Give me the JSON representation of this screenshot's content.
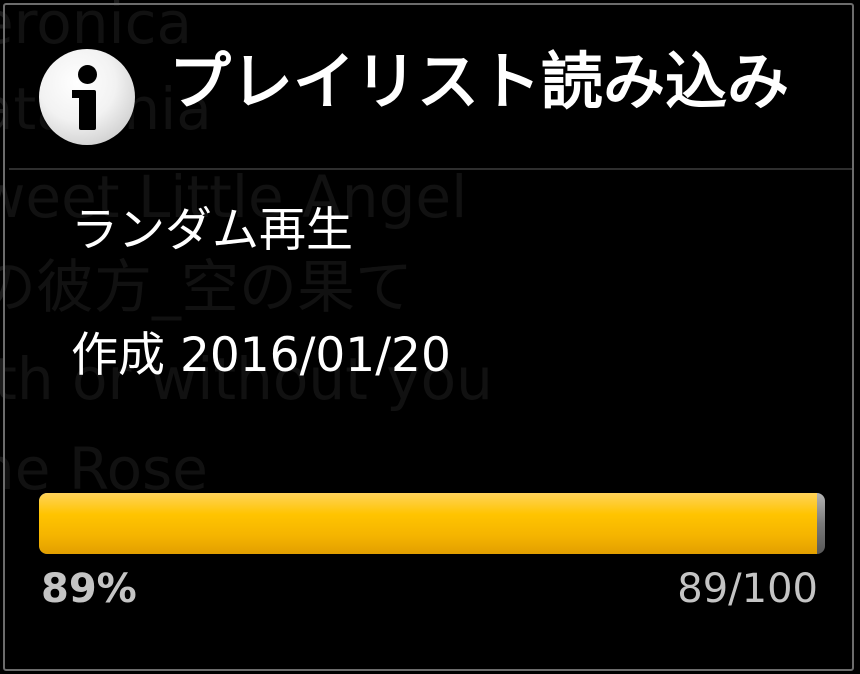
{
  "background_list": {
    "items": [
      "eronica",
      "atalonia",
      "weet Little Angel",
      "の彼方_空の果て",
      "ith or without you",
      "ne Rose"
    ]
  },
  "dialog": {
    "title": "プレイリスト読み込み",
    "icon": "info-icon",
    "playlist_name": "ランダム再生",
    "created_label": "作成",
    "created_date": "2016/01/20",
    "progress": {
      "fraction": 0.99,
      "percent_text": "89%",
      "count_text": "89/100"
    }
  },
  "colors": {
    "progress_fill": "#ffc400",
    "progress_track": "#7a7a7a",
    "text": "#ffffff",
    "secondary_text": "#c4c4c4",
    "background": "#000000"
  }
}
